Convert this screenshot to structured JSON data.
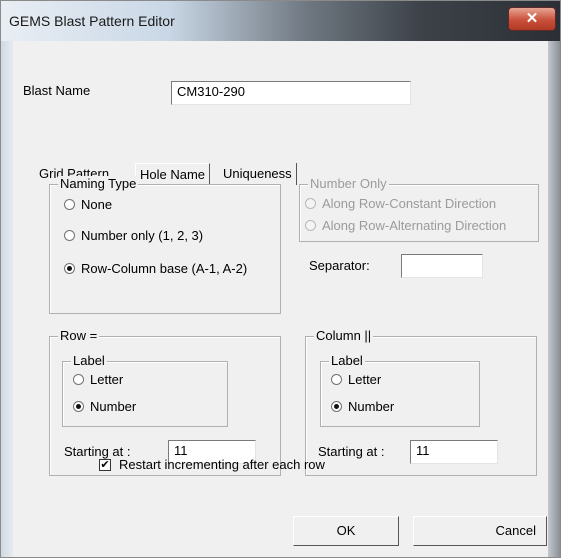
{
  "window": {
    "title": "GEMS Blast Pattern Editor",
    "close_glyph": "✕"
  },
  "blast_name": {
    "label": "Blast Name",
    "value": "CM310-290"
  },
  "tabs": [
    {
      "label": "Grid Pattern",
      "active": false
    },
    {
      "label": "Hole Name",
      "active": true
    },
    {
      "label": "Uniqueness",
      "active": false
    }
  ],
  "naming_type": {
    "title": "Naming Type",
    "options": [
      {
        "label": "None",
        "selected": false
      },
      {
        "label": "Number only (1, 2, 3)",
        "selected": false
      },
      {
        "label": "Row-Column base (A-1, A-2)",
        "selected": true
      }
    ]
  },
  "number_only": {
    "title": "Number Only",
    "options": [
      {
        "label": "Along Row-Constant Direction",
        "selected": false
      },
      {
        "label": "Along Row-Alternating Direction",
        "selected": false
      }
    ]
  },
  "separator": {
    "label": "Separator:",
    "value": ""
  },
  "row": {
    "title": "Row =",
    "label_group_title": "Label",
    "options": [
      {
        "label": "Letter",
        "selected": false
      },
      {
        "label": "Number",
        "selected": true
      }
    ],
    "starting_label": "Starting at :",
    "starting_value": "11"
  },
  "column": {
    "title": "Column ||",
    "label_group_title": "Label",
    "options": [
      {
        "label": "Letter",
        "selected": false
      },
      {
        "label": "Number",
        "selected": true
      }
    ],
    "starting_label": "Starting at :",
    "starting_value": "11"
  },
  "restart": {
    "label": "Restart incrementing after each row",
    "checked": true,
    "check_glyph": "✔"
  },
  "buttons": {
    "ok": "OK",
    "cancel": "Cancel"
  }
}
